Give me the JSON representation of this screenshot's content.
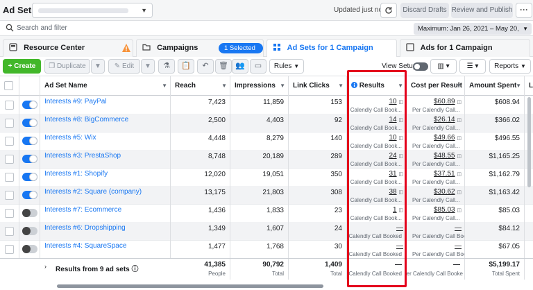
{
  "app": {
    "title": "Ad Sets",
    "account_selector": ""
  },
  "header": {
    "updated": "Updated just now",
    "discard": "Discard Drafts",
    "review": "Review and Publish",
    "more": "···"
  },
  "search": {
    "placeholder": "Search and filter"
  },
  "date_range": "Maximum: Jan 26, 2021 – May 20, 2021",
  "tabs": {
    "resource_center": "Resource Center",
    "campaigns": "Campaigns",
    "selected_badge": "1 Selected  ×",
    "ad_sets": "Ad Sets for 1 Campaign",
    "ads": "Ads for 1 Campaign"
  },
  "toolbar": {
    "create": "+ Create",
    "duplicate": "Duplicate",
    "edit": "Edit",
    "rules": "Rules",
    "view_setup": "View Setup",
    "reports": "Reports"
  },
  "columns": {
    "name": "Ad Set Name",
    "reach": "Reach",
    "impressions": "Impressions",
    "link_clicks": "Link Clicks",
    "results": "Results",
    "cost_per_result": "Cost per Result",
    "amount_spent": "Amount Spent",
    "extra": "Le"
  },
  "rows": [
    {
      "name": "Interests #9: PayPal",
      "on": true,
      "reach": "7,423",
      "impressions": "11,859",
      "clicks": "153",
      "results": "10",
      "results_sub": "Calendly Call Book...",
      "cpr": "$60.89",
      "cpr_sub": "Per Calendly Call...",
      "spent": "$608.94"
    },
    {
      "name": "Interests #8: BigCommerce",
      "on": true,
      "reach": "2,500",
      "impressions": "4,403",
      "clicks": "92",
      "results": "14",
      "results_sub": "Calendly Call Book...",
      "cpr": "$26.14",
      "cpr_sub": "Per Calendly Call...",
      "spent": "$366.02"
    },
    {
      "name": "Interests #5: Wix",
      "on": true,
      "reach": "4,448",
      "impressions": "8,279",
      "clicks": "140",
      "results": "10",
      "results_sub": "Calendly Call Book...",
      "cpr": "$49.66",
      "cpr_sub": "Per Calendly Call...",
      "spent": "$496.55"
    },
    {
      "name": "Interests #3: PrestaShop",
      "on": true,
      "reach": "8,748",
      "impressions": "20,189",
      "clicks": "289",
      "results": "24",
      "results_sub": "Calendly Call Book...",
      "cpr": "$48.55",
      "cpr_sub": "Per Calendly Call...",
      "spent": "$1,165.25"
    },
    {
      "name": "Interests #1: Shopify",
      "on": true,
      "reach": "12,020",
      "impressions": "19,051",
      "clicks": "350",
      "results": "31",
      "results_sub": "Calendly Call Book...",
      "cpr": "$37.51",
      "cpr_sub": "Per Calendly Call...",
      "spent": "$1,162.79"
    },
    {
      "name": "Interests #2: Square (company)",
      "on": true,
      "reach": "13,175",
      "impressions": "21,803",
      "clicks": "308",
      "results": "38",
      "results_sub": "Calendly Call Book...",
      "cpr": "$30.62",
      "cpr_sub": "Per Calendly Call...",
      "spent": "$1,163.42"
    },
    {
      "name": "Interests #7: Ecommerce",
      "on": false,
      "reach": "1,436",
      "impressions": "1,833",
      "clicks": "23",
      "results": "1",
      "results_sub": "Calendly Call Book...",
      "cpr": "$85.03",
      "cpr_sub": "Per Calendly Call...",
      "spent": "$85.03"
    },
    {
      "name": "Interests #6: Dropshipping",
      "on": false,
      "reach": "1,349",
      "impressions": "1,607",
      "clicks": "24",
      "results": "—",
      "results_sub": "Calendly Call Booked",
      "cpr": "—",
      "cpr_sub": "Per Calendly Call Boo...",
      "spent": "$84.12"
    },
    {
      "name": "Interests #4: SquareSpace",
      "on": false,
      "reach": "1,477",
      "impressions": "1,768",
      "clicks": "30",
      "results": "—",
      "results_sub": "Calendly Call Booked",
      "cpr": "—",
      "cpr_sub": "Per Calendly Call Boo...",
      "spent": "$67.05"
    }
  ],
  "summary": {
    "label": "Results from 9 ad sets",
    "reach": "41,385",
    "reach_sub": "People",
    "impressions": "90,792",
    "impressions_sub": "Total",
    "clicks": "1,409",
    "clicks_sub": "Total",
    "results": "—",
    "results_sub": "Calendly Call Booked",
    "cpr": "—",
    "cpr_sub": "Per Calendly Call Booke",
    "spent": "$5,199.17",
    "spent_sub": "Total Spent"
  },
  "colors": {
    "accent": "#1877f2",
    "create": "#42b72a",
    "highlight": "#e4001b"
  }
}
